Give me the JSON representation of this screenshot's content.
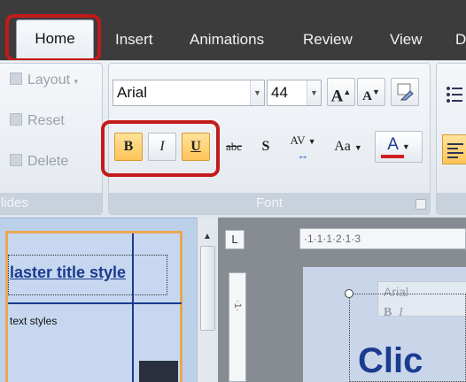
{
  "tabs": [
    {
      "label": "Home",
      "active": true
    },
    {
      "label": "Insert",
      "active": false
    },
    {
      "label": "Animations",
      "active": false
    },
    {
      "label": "Review",
      "active": false
    },
    {
      "label": "View",
      "active": false
    },
    {
      "label": "D",
      "active": false
    }
  ],
  "slides_group": {
    "label": "lides",
    "layout_label": "Layout",
    "reset_label": "Reset",
    "delete_label": "Delete"
  },
  "font_group": {
    "label": "Font",
    "font_name": "Arial",
    "font_size": "44",
    "grow_label": "A",
    "shrink_label": "A",
    "bold_label": "B",
    "italic_label": "I",
    "underline_label": "U",
    "strike_label": "abc",
    "shadow_label": "S",
    "spacing_label": "AV",
    "case_label": "Aa",
    "color_label": "A"
  },
  "slide_thumbnail": {
    "title": "laster title style",
    "body": "text styles"
  },
  "ruler": {
    "horizontal": "·1·1·1·2·1·3",
    "vertical": "·1·"
  },
  "mini_toolbar": {
    "font": "Arial",
    "bold": "B",
    "italic": "I"
  },
  "slide_canvas_text": "Clic",
  "colors": {
    "highlight_box": "#c41a1a",
    "active_toggle": "#ffc45a",
    "title_blue": "#1b3b8f",
    "font_color_bar": "#d21e1e"
  }
}
